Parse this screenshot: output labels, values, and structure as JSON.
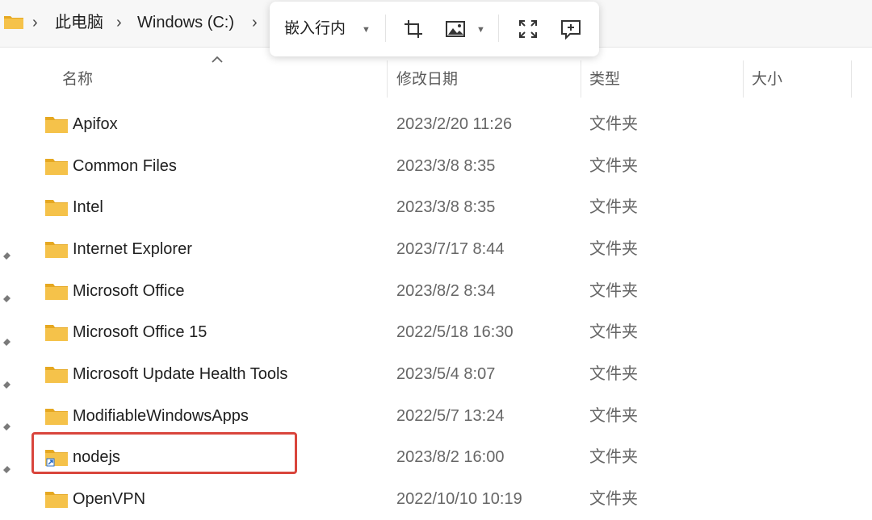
{
  "addressbar": {
    "breadcrumbs": [
      "此电脑",
      "Windows (C:)"
    ],
    "separator": "›"
  },
  "toolbar": {
    "embed_label": "嵌入行内",
    "icons": [
      "crop-icon",
      "image-icon",
      "expand-icon",
      "comment-add-icon"
    ]
  },
  "header": {
    "columns": [
      "名称",
      "修改日期",
      "类型",
      "大小"
    ],
    "sort_column": "名称",
    "sort_direction": "ascending"
  },
  "rows": [
    {
      "name": "Apifox",
      "date": "2023/2/20 11:26",
      "type": "文件夹",
      "icon": "folder-icon"
    },
    {
      "name": "Common Files",
      "date": "2023/3/8 8:35",
      "type": "文件夹",
      "icon": "folder-icon"
    },
    {
      "name": "Intel",
      "date": "2023/3/8 8:35",
      "type": "文件夹",
      "icon": "folder-icon"
    },
    {
      "name": "Internet Explorer",
      "date": "2023/7/17 8:44",
      "type": "文件夹",
      "icon": "folder-icon"
    },
    {
      "name": "Microsoft Office",
      "date": "2023/8/2 8:34",
      "type": "文件夹",
      "icon": "folder-icon"
    },
    {
      "name": "Microsoft Office 15",
      "date": "2022/5/18 16:30",
      "type": "文件夹",
      "icon": "folder-icon"
    },
    {
      "name": "Microsoft Update Health Tools",
      "date": "2023/5/4 8:07",
      "type": "文件夹",
      "icon": "folder-icon"
    },
    {
      "name": "ModifiableWindowsApps",
      "date": "2022/5/7 13:24",
      "type": "文件夹",
      "icon": "folder-icon"
    },
    {
      "name": "nodejs",
      "date": "2023/8/2 16:00",
      "type": "文件夹",
      "icon": "folder-shortcut-icon",
      "highlighted": true
    },
    {
      "name": "OpenVPN",
      "date": "2022/10/10 10:19",
      "type": "文件夹",
      "icon": "folder-icon"
    }
  ],
  "colors": {
    "folder": "#f5c24a",
    "folder_dark": "#e6a821",
    "highlight": "#d9453c"
  }
}
